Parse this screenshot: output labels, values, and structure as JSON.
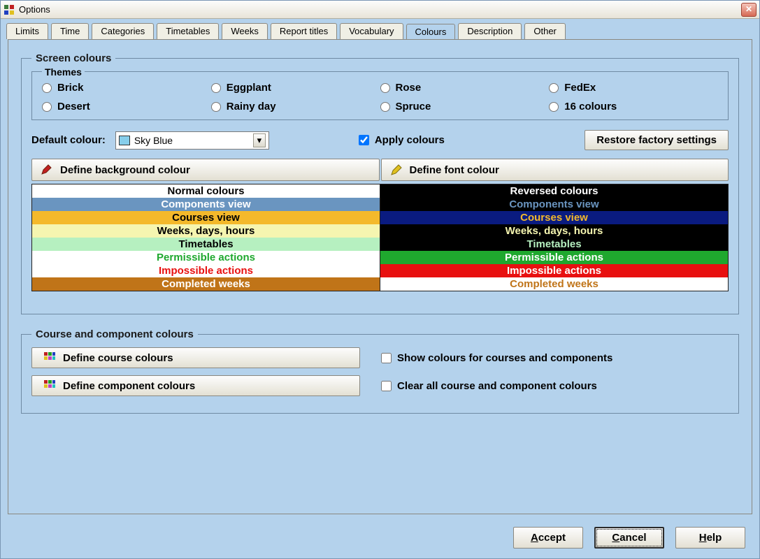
{
  "window": {
    "title": "Options"
  },
  "tabs": [
    "Limits",
    "Time",
    "Categories",
    "Timetables",
    "Weeks",
    "Report titles",
    "Vocabulary",
    "Colours",
    "Description",
    "Other"
  ],
  "active_tab": "Colours",
  "screen_colours": {
    "legend": "Screen colours",
    "themes_legend": "Themes",
    "themes": [
      "Brick",
      "Eggplant",
      "Rose",
      "FedEx",
      "Desert",
      "Rainy day",
      "Spruce",
      "16 colours"
    ],
    "default_colour_label": "Default colour:",
    "default_colour_value": "Sky Blue",
    "default_colour_swatch": "#87ceeb",
    "apply_colours_label": "Apply colours",
    "apply_colours_checked": true,
    "restore_label": "Restore factory settings",
    "define_bg": "Define background colour",
    "define_font": "Define font colour",
    "table_head_normal": "Normal colours",
    "table_head_reversed": "Reversed colours",
    "rows": [
      {
        "label": "Components view",
        "nbg": "#6a95c0",
        "nfg": "#ffffff",
        "rbg": "#000000",
        "rfg": "#6a95c0"
      },
      {
        "label": "Courses view",
        "nbg": "#f4b92b",
        "nfg": "#000000",
        "rbg": "#0a1b80",
        "rfg": "#f4b92b"
      },
      {
        "label": "Weeks, days, hours",
        "nbg": "#f5f5b0",
        "nfg": "#000000",
        "rbg": "#000000",
        "rfg": "#f5f5b0"
      },
      {
        "label": "Timetables",
        "nbg": "#b6f0c0",
        "nfg": "#000000",
        "rbg": "#000000",
        "rfg": "#b6f0c0"
      },
      {
        "label": "Permissible actions",
        "nbg": "#ffffff",
        "nfg": "#1fa82e",
        "rbg": "#1fa82e",
        "rfg": "#ffffff"
      },
      {
        "label": "Impossible actions",
        "nbg": "#ffffff",
        "nfg": "#e81010",
        "rbg": "#e81010",
        "rfg": "#ffffff"
      },
      {
        "label": "Completed weeks",
        "nbg": "#c07418",
        "nfg": "#ffffff",
        "rbg": "#ffffff",
        "rfg": "#c07418"
      }
    ]
  },
  "course_colours": {
    "legend": "Course and component colours",
    "define_course": "Define course colours",
    "define_component": "Define component colours",
    "show_colours_label": "Show colours for courses and components",
    "show_colours_checked": false,
    "clear_colours_label": "Clear all course and component colours",
    "clear_colours_checked": false
  },
  "buttons": {
    "accept": "Accept",
    "cancel": "Cancel",
    "help": "Help"
  }
}
